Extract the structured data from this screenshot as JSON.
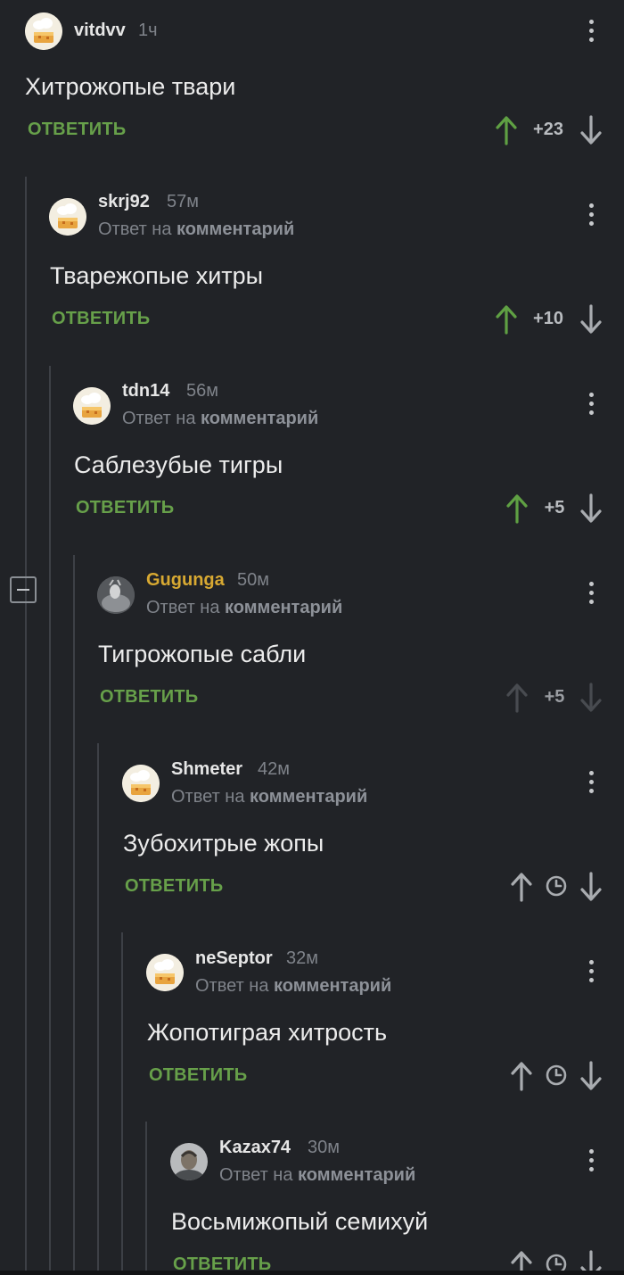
{
  "reply_label": "ОТВЕТИТЬ",
  "reply_to_prefix": "Ответ на",
  "reply_to_target": "комментарий",
  "colors": {
    "background": "#212327",
    "reply_green": "#67a04a",
    "upvote_green": "#5fa043",
    "muted": "#7f838a",
    "highlight_user": "#d8a932"
  },
  "comments": [
    {
      "username": "vitdvv",
      "time": "1ч",
      "text": "Хитрожопые твари",
      "score": "+23",
      "upvoted": true,
      "avatar": "chef-cake-avatar"
    },
    {
      "username": "skrj92",
      "time": "57м",
      "text": "Тварежопые хитры",
      "score": "+10",
      "upvoted": true,
      "avatar": "chef-cake-avatar"
    },
    {
      "username": "tdn14",
      "time": "56м",
      "text": "Саблезубые тигры",
      "score": "+5",
      "upvoted": true,
      "avatar": "chef-cake-avatar"
    },
    {
      "username": "Gugunga",
      "time": "50м",
      "text": "Тигрожопые сабли",
      "score": "+5",
      "upvoted": false,
      "avatar": "grey-photo-avatar",
      "highlighted": true
    },
    {
      "username": "Shmeter",
      "time": "42м",
      "text": "Зубохитрые жопы",
      "score": "",
      "pending": true,
      "avatar": "chef-cake-avatar"
    },
    {
      "username": "neSeptor",
      "time": "32м",
      "text": "Жопотиграя хитрость",
      "score": "",
      "pending": true,
      "avatar": "chef-cake-avatar"
    },
    {
      "username": "Kazax74",
      "time": "30м",
      "text": "Восьмижопый семихуй",
      "score": "",
      "pending": true,
      "avatar": "man-photo-avatar"
    }
  ]
}
